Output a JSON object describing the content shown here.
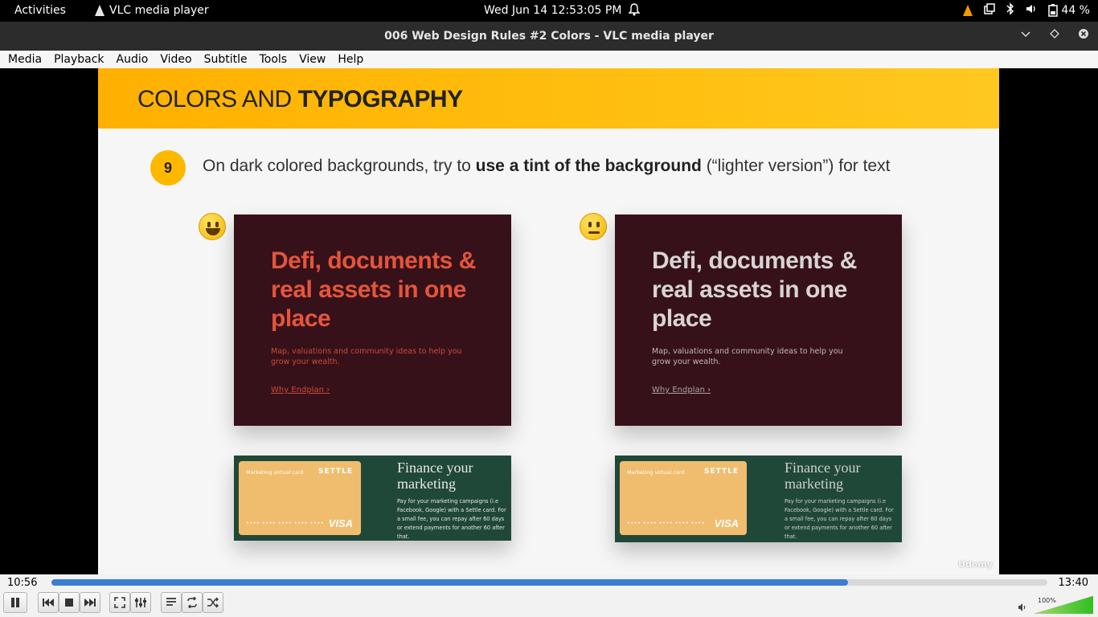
{
  "topbar": {
    "activities": "Activities",
    "app_name": "VLC media player",
    "clock": "Wed Jun 14  12:53:05 PM",
    "battery": "44 %"
  },
  "window": {
    "title": "006 Web Design Rules #2 Colors - VLC media player"
  },
  "menu": {
    "items": [
      "Media",
      "Playback",
      "Audio",
      "Video",
      "Subtitle",
      "Tools",
      "View",
      "Help"
    ]
  },
  "slide": {
    "title_light": "COLORS AND ",
    "title_bold": "TYPOGRAPHY",
    "rule_number": "9",
    "rule_pre": "On dark colored backgrounds, try to ",
    "rule_bold": "use a tint of the background",
    "rule_post": " (“lighter version”) for text",
    "good_example": {
      "headline": "Defi, documents & real assets in one place",
      "sub": "Map, valuations and community ideas to help you grow your wealth.",
      "link": "Why Endplan ›",
      "text_color": "#e4553c"
    },
    "bad_example": {
      "headline": "Defi, documents & real assets in one place",
      "sub": "Map, valuations and community ideas to help you grow your wealth.",
      "link": "Why Endplan ›",
      "text_color": "#d8d4d4"
    },
    "finance_card": {
      "card_label": "Marketing virtual card",
      "brand": "SETTLE",
      "card_number": "•••• •••• •••• •••• ••••",
      "network": "VISA",
      "title": "Finance your marketing",
      "desc": "Pay for your marketing campaigns (i.e Facebook, Google) with a Settle card. For a small fee, you can repay after 60 days or extend payments for another 60 after that."
    },
    "watermark": "Udemy",
    "colors": {
      "header": "#ffb800",
      "dark_card": "#371119",
      "green_card": "#204839"
    }
  },
  "player": {
    "elapsed": "10:56",
    "total": "13:40",
    "progress_fraction": 0.8,
    "volume_label": "100%",
    "volume_fraction": 1.0,
    "buttons": [
      "pause-icon",
      "previous-icon",
      "stop-icon",
      "next-icon",
      "fullscreen-icon",
      "extended-settings-icon",
      "playlist-icon",
      "loop-icon",
      "shuffle-icon"
    ]
  }
}
